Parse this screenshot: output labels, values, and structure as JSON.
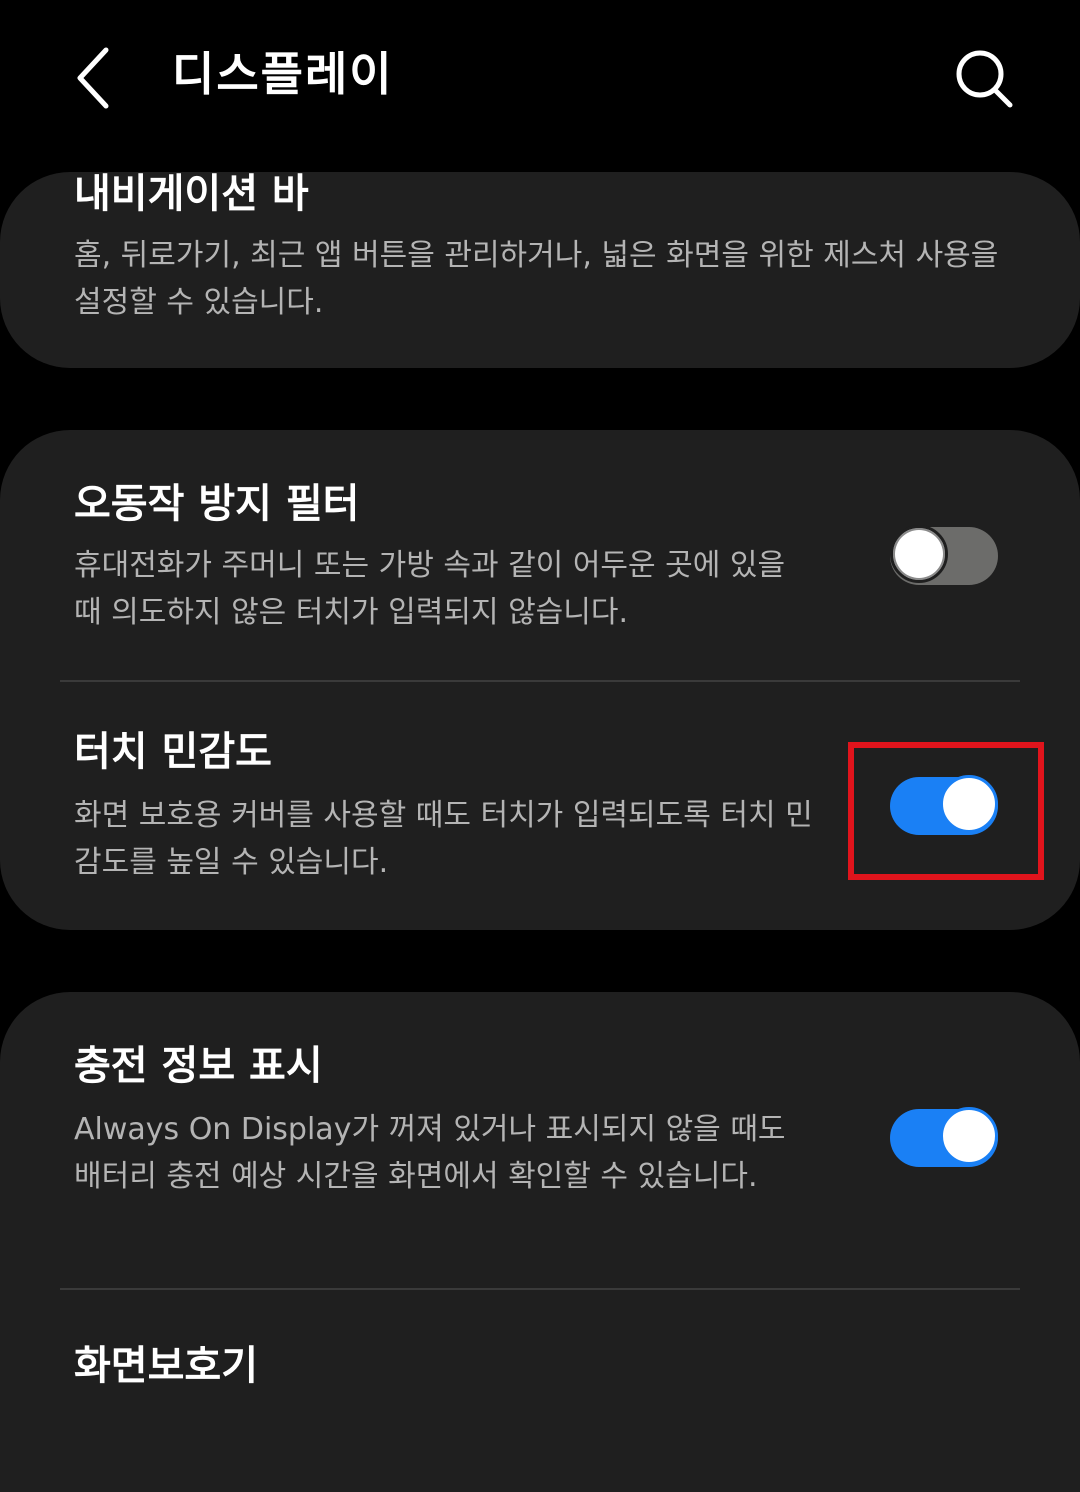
{
  "header": {
    "title": "디스플레이",
    "back_icon": "chevron-left-icon",
    "search_icon": "search-icon"
  },
  "navigation_bar": {
    "title": "내비게이션 바",
    "description": "홈, 뒤로가기, 최근 앱 버튼을 관리하거나, 넓은 화면을 위한 제스처 사용을 설정할 수 있습니다."
  },
  "accidental_touch": {
    "title": "오동작 방지 필터",
    "description": "휴대전화가 주머니 또는 가방 속과 같이 어두운 곳에 있을 때 의도하지 않은 터치가 입력되지 않습니다.",
    "toggle_state": "off"
  },
  "touch_sensitivity": {
    "title": "터치 민감도",
    "description": "화면 보호용 커버를 사용할 때도 터치가 입력되도록 터치 민감도를 높일 수 있습니다.",
    "toggle_state": "on",
    "highlighted": true
  },
  "charging_info": {
    "title": "충전 정보 표시",
    "description": "Always On Display가 꺼져 있거나 표시되지 않을 때도 배터리 충전 예상 시간을 화면에서 확인할 수 있습니다.",
    "toggle_state": "on"
  },
  "screen_saver": {
    "title": "화면보호기"
  },
  "colors": {
    "background": "#000000",
    "card": "#1f1f1f",
    "toggle_on": "#1a80f5",
    "toggle_off": "#6c6c6a",
    "highlight": "#e0141c",
    "description_text": "#b4b4b4"
  }
}
